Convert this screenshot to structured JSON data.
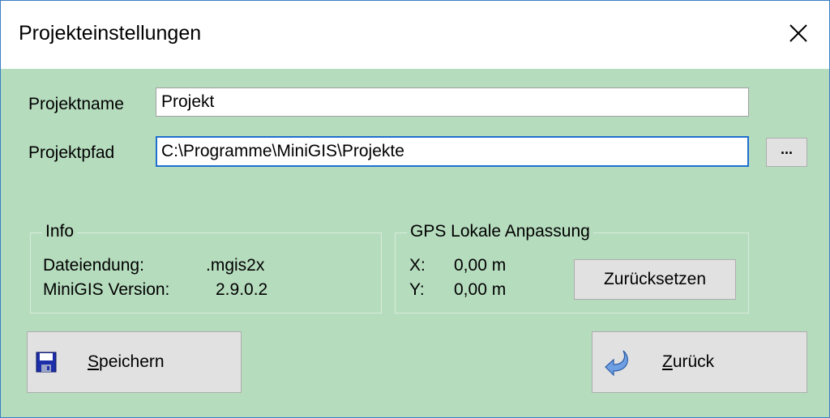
{
  "window": {
    "title": "Projekteinstellungen"
  },
  "form": {
    "name_label": "Projektname",
    "name_value": "Projekt",
    "path_label": "Projektpfad",
    "path_value": "C:\\Programme\\MiniGIS\\Projekte",
    "browse_label": "..."
  },
  "info": {
    "caption": "Info",
    "ext_label": "Dateiendung:",
    "ext_value": ".mgis2x",
    "version_label": "MiniGIS Version:",
    "version_value": "2.9.0.2"
  },
  "gps": {
    "caption": "GPS Lokale Anpassung",
    "x_label": "X:",
    "x_value": "0,00 m",
    "y_label": "Y:",
    "y_value": "0,00 m",
    "reset_label": "Zurücksetzen"
  },
  "actions": {
    "save_mnemonic": "S",
    "save_rest": "peichern",
    "back_mnemonic": "Z",
    "back_rest": "urück"
  },
  "icons": {
    "save": "floppy-disk-icon",
    "back": "back-arrow-icon",
    "close": "close-icon"
  },
  "colors": {
    "dialog_bg": "#b6dcbe",
    "focus_border": "#1f6fd0",
    "window_border": "#3b7fc4"
  }
}
